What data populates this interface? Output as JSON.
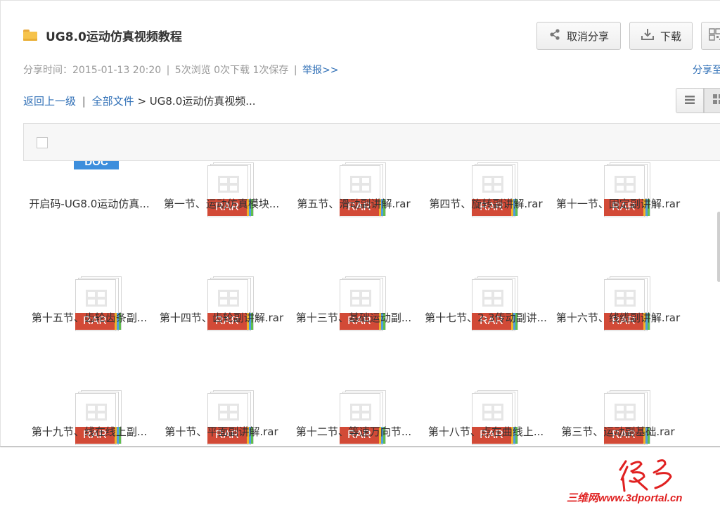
{
  "header": {
    "title": "UG8.0运动仿真视频教程",
    "cancel_share_label": "取消分享",
    "download_label": "下载"
  },
  "meta": {
    "share_time": "分享时间：2015-01-13 20:20",
    "sep": "|",
    "stats": "5次浏览 0次下载 1次保存",
    "report_label": "举报>>",
    "share_to_label": "分享至"
  },
  "breadcrumb": {
    "back_label": "返回上一级",
    "sep": "|",
    "all_files_label": "全部文件",
    "current": "> UG8.0运动仿真视频..."
  },
  "files": [
    {
      "name": "开启码-UG8.0运动仿真...",
      "type": "DOC"
    },
    {
      "name": "第一节、运动仿真模块...",
      "type": "RAR"
    },
    {
      "name": "第五节、滑动副讲解.rar",
      "type": "RAR"
    },
    {
      "name": "第四节、旋转副讲解.rar",
      "type": "RAR"
    },
    {
      "name": "第十一节、固定副讲解.rar",
      "type": "RAR"
    },
    {
      "name": "第十五节、齿轮齿条副...",
      "type": "RAR"
    },
    {
      "name": "第十四节、齿轮副讲解.rar",
      "type": "RAR"
    },
    {
      "name": "第十三节、基础运动副...",
      "type": "RAR"
    },
    {
      "name": "第十七节、2-3传动副讲...",
      "type": "RAR"
    },
    {
      "name": "第十六节、线缆副讲解.rar",
      "type": "RAR"
    },
    {
      "name": "第十九节、线在线上副...",
      "type": "RAR"
    },
    {
      "name": "第十节、平面副讲解.rar",
      "type": "RAR"
    },
    {
      "name": "第十二节、等速万向节...",
      "type": "RAR"
    },
    {
      "name": "第十八节、点在曲线上...",
      "type": "RAR"
    },
    {
      "name": "第三节、运动副基础.rar",
      "type": "RAR"
    }
  ],
  "watermark": {
    "text": "三维网www.3dportal.cn"
  },
  "colors": {
    "link": "#2f6fb6",
    "rar_badge": "#d24a37",
    "doc_badge": "#3d8edc",
    "watermark": "#e02121"
  }
}
